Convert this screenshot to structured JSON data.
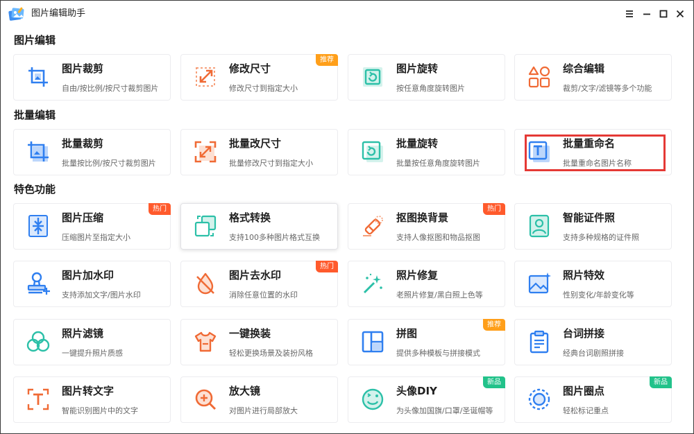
{
  "app": {
    "title": "图片编辑助手"
  },
  "window_controls": [
    "菜单",
    "最小化",
    "最大化",
    "关闭"
  ],
  "colors": {
    "blue": "#2f7ff0",
    "teal": "#2cc0a8",
    "orange": "#f06a35",
    "badge_recommend": "#ff9f1a",
    "badge_hot": "#ff5a2c",
    "badge_new": "#22c28a",
    "highlight": "#e53935"
  },
  "sections": [
    {
      "title": "图片编辑",
      "cards": [
        {
          "name": "图片裁剪",
          "desc": "自由/按比例/按尺寸裁剪图片",
          "icon": "crop-icon"
        },
        {
          "name": "修改尺寸",
          "desc": "修改尺寸到指定大小",
          "icon": "resize-icon",
          "badge": "推荐"
        },
        {
          "name": "图片旋转",
          "desc": "按任意角度旋转图片",
          "icon": "rotate-icon"
        },
        {
          "name": "综合编辑",
          "desc": "裁剪/文字/滤镜等多个功能",
          "icon": "shapes-icon"
        }
      ]
    },
    {
      "title": "批量编辑",
      "cards": [
        {
          "name": "批量裁剪",
          "desc": "批量按比例/按尺寸裁剪图片",
          "icon": "batch-crop-icon"
        },
        {
          "name": "批量改尺寸",
          "desc": "批量修改尺寸到指定大小",
          "icon": "batch-resize-icon"
        },
        {
          "name": "批量旋转",
          "desc": "批量按任意角度旋转图片",
          "icon": "batch-rotate-icon"
        },
        {
          "name": "批量重命名",
          "desc": "批量重命名图片名称",
          "icon": "rename-icon"
        }
      ]
    },
    {
      "title": "特色功能",
      "cards": [
        {
          "name": "图片压缩",
          "desc": "压缩图片至指定大小",
          "icon": "compress-icon",
          "badge": "热门"
        },
        {
          "name": "格式转换",
          "desc": "支持100多种图片格式互换",
          "icon": "convert-icon"
        },
        {
          "name": "抠图换背景",
          "desc": "支持人像抠图和物品抠图",
          "icon": "eraser-icon",
          "badge": "热门"
        },
        {
          "name": "智能证件照",
          "desc": "支持多种规格的证件照",
          "icon": "id-photo-icon"
        },
        {
          "name": "图片加水印",
          "desc": "支持添加文字/图片水印",
          "icon": "stamp-icon"
        },
        {
          "name": "图片去水印",
          "desc": "消除任意位置的水印",
          "icon": "drop-icon",
          "badge": "热门"
        },
        {
          "name": "照片修复",
          "desc": "老照片修复/黑白照上色等",
          "icon": "magic-wand-icon"
        },
        {
          "name": "照片特效",
          "desc": "性别变化/年龄变化等",
          "icon": "image-effect-icon"
        },
        {
          "name": "照片滤镜",
          "desc": "一键提升照片质感",
          "icon": "filter-icon"
        },
        {
          "name": "一键换装",
          "desc": "轻松更换场景及装扮风格",
          "icon": "tshirt-icon"
        },
        {
          "name": "拼图",
          "desc": "提供多种模板与拼接模式",
          "icon": "collage-icon",
          "badge": "推荐"
        },
        {
          "name": "台词拼接",
          "desc": "经典台词剧照拼接",
          "icon": "clipboard-icon"
        },
        {
          "name": "图片转文字",
          "desc": "智能识别图片中的文字",
          "icon": "ocr-icon"
        },
        {
          "name": "放大镜",
          "desc": "对图片进行局部放大",
          "icon": "magnifier-icon"
        },
        {
          "name": "头像DIY",
          "desc": "为头像加国旗/口罩/圣诞帽等",
          "icon": "smiley-icon",
          "badge": "新品"
        },
        {
          "name": "图片圈点",
          "desc": "轻松标记重点",
          "icon": "circle-mark-icon",
          "badge": "新品"
        }
      ]
    }
  ]
}
